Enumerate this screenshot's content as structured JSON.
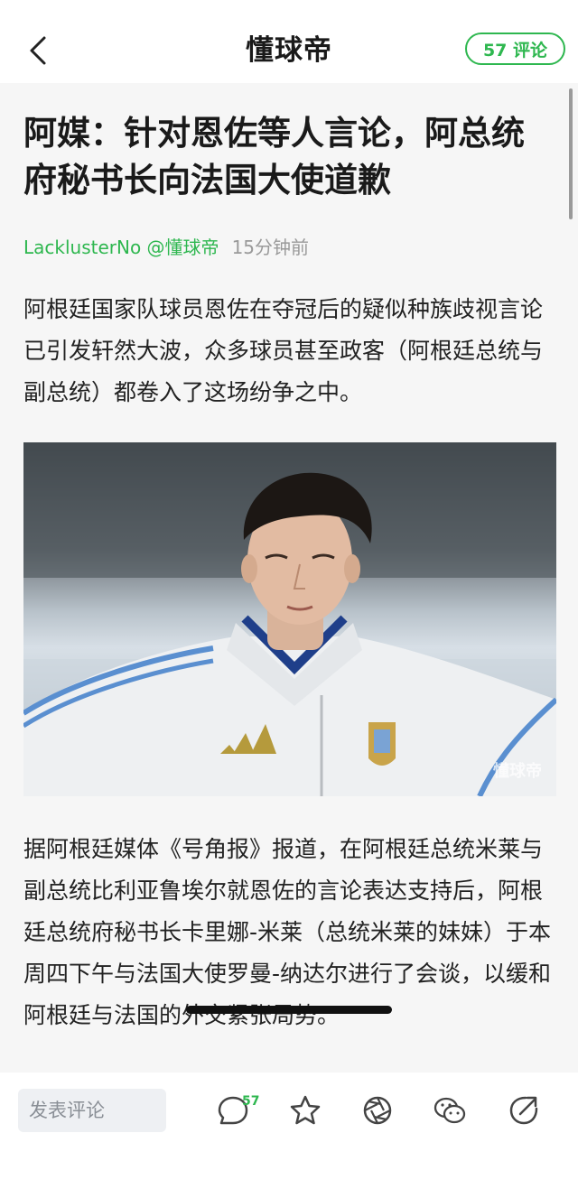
{
  "nav": {
    "logo": "懂球帝",
    "comment_count_label": "57 评论"
  },
  "article": {
    "title": "阿媒：针对恩佐等人言论，阿总统府秘书长向法国大使道歉",
    "author": "LacklusterNo @懂球帝",
    "time": "15分钟前",
    "paragraph1": "阿根廷国家队球员恩佐在夺冠后的疑似种族歧视言论已引发轩然大波，众多球员甚至政客（阿根廷总统与副总统）都卷入了这场纷争之中。",
    "image_watermark": "懂球帝",
    "paragraph2": "据阿根廷媒体《号角报》报道，在阿根廷总统米莱与副总统比利亚鲁埃尔就恩佐的言论表达支持后，阿根廷总统府秘书长卡里娜-米莱（总统米莱的妹妹）于本周四下午与法国大使罗曼-纳达尔进行了会谈，以缓和阿根廷与法国的外交紧张局势。"
  },
  "bottombar": {
    "comment_placeholder": "发表评论",
    "comment_badge": "57",
    "icons": [
      "comment-icon",
      "star-icon",
      "aperture-icon",
      "wechat-icon",
      "share-icon"
    ]
  },
  "colors": {
    "accent": "#2eb74f",
    "content_bg": "#f6f6f6",
    "muted": "#9a9a9a"
  }
}
